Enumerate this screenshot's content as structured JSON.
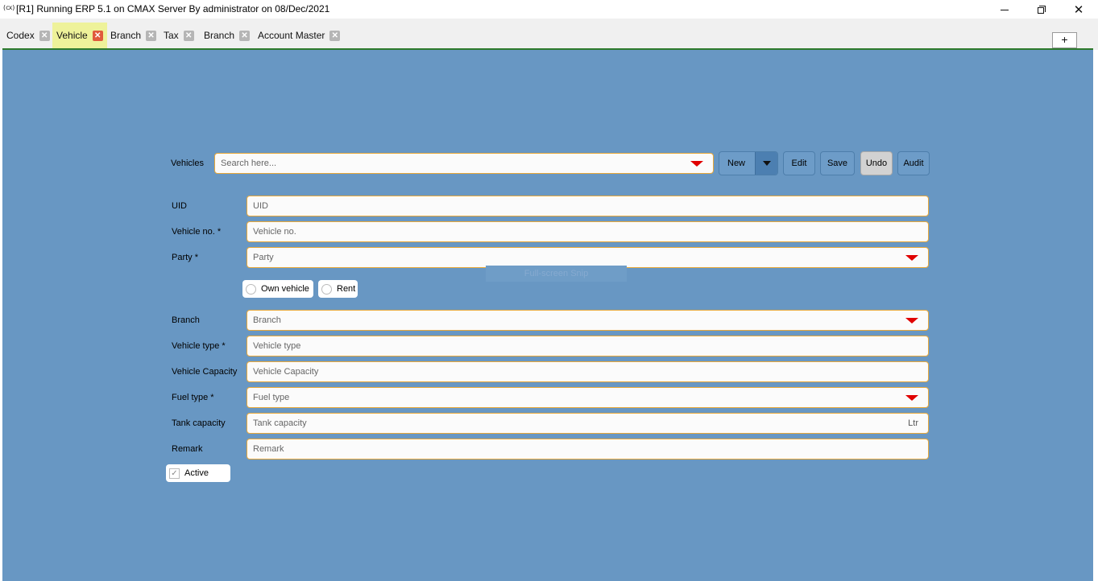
{
  "window": {
    "icon_text": "(cx)",
    "title": "[R1] Running ERP 5.1 on CMAX Server By administrator on 08/Dec/2021",
    "close_glyph": "✕"
  },
  "tabs": [
    {
      "label": "Codex",
      "active": false
    },
    {
      "label": "Vehicle",
      "active": true
    },
    {
      "label": "Branch",
      "active": false
    },
    {
      "label": "Tax",
      "active": false
    },
    {
      "label": "Branch",
      "active": false
    },
    {
      "label": "Account Master",
      "active": false
    }
  ],
  "tab_close_glyph": "✕",
  "add_tab_label": "+",
  "toolbar": {
    "search_label": "Vehicles",
    "search_placeholder": "Search here...",
    "new_label": "New",
    "edit_label": "Edit",
    "save_label": "Save",
    "undo_label": "Undo",
    "audit_label": "Audit"
  },
  "form": {
    "uid": {
      "label": "UID",
      "placeholder": "UID"
    },
    "vehicle_no": {
      "label": "Vehicle no. *",
      "placeholder": "Vehicle no."
    },
    "party": {
      "label": "Party *",
      "placeholder": "Party"
    },
    "ownership": {
      "own_label": "Own vehicle",
      "rent_label": "Rent"
    },
    "branch": {
      "label": "Branch",
      "placeholder": "Branch"
    },
    "vehicle_type": {
      "label": "Vehicle type *",
      "placeholder": "Vehicle type"
    },
    "vehicle_capacity": {
      "label": "Vehicle Capacity",
      "placeholder": "Vehicle Capacity"
    },
    "fuel_type": {
      "label": "Fuel type *",
      "placeholder": "Fuel type"
    },
    "tank_capacity": {
      "label": "Tank capacity",
      "placeholder": "Tank capacity",
      "unit": "Ltr"
    },
    "remark": {
      "label": "Remark",
      "placeholder": "Remark"
    },
    "active": {
      "label": "Active",
      "checked": true,
      "check_glyph": "✓"
    }
  },
  "overlay": {
    "snip_text": "Full-screen Snip"
  },
  "colors": {
    "panel_bg": "#6897c3",
    "field_border": "#e8a83a",
    "dropdown_arrow": "#e00000",
    "active_tab_bg": "#eef29a",
    "active_tab_close": "#e05a3c"
  }
}
